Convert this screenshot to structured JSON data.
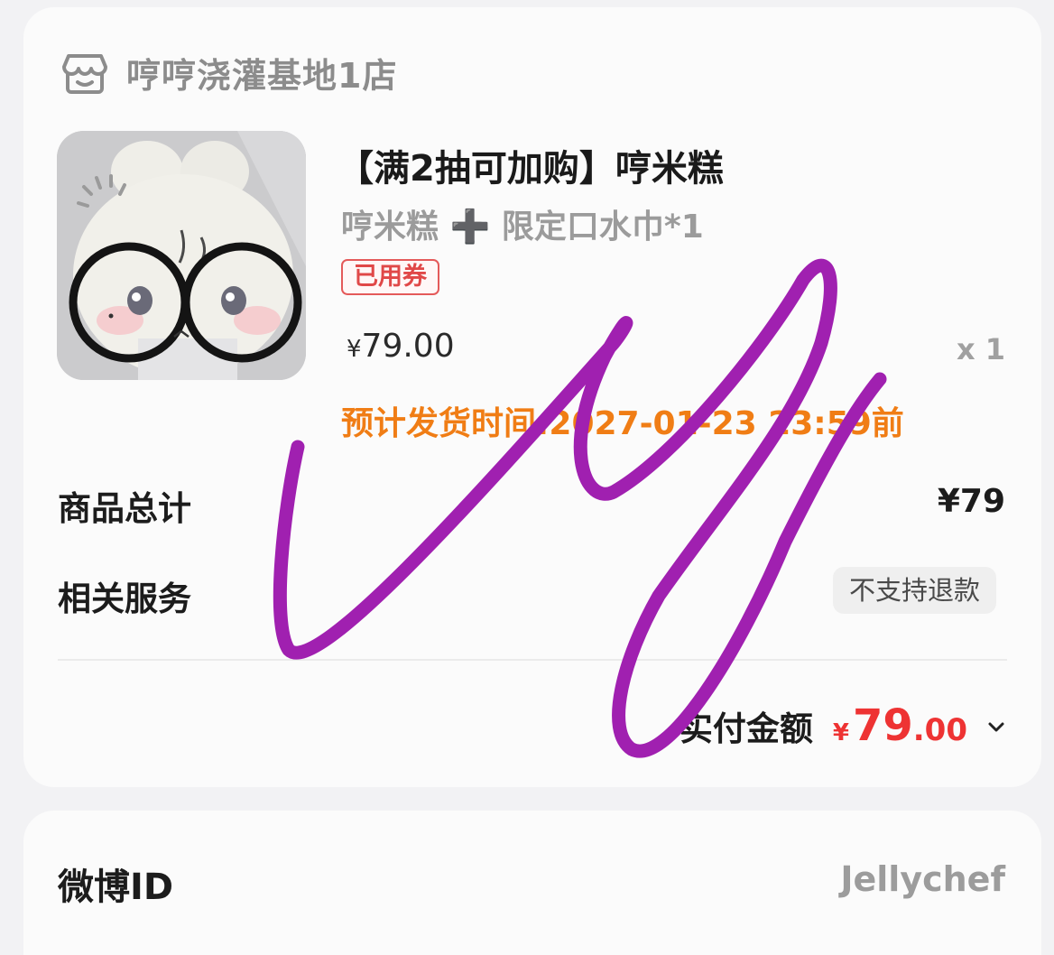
{
  "shop": {
    "name": "哼哼浇灌基地1店",
    "icon": "store-icon"
  },
  "product": {
    "title": "【满2抽可加购】哼米糕",
    "variant": "哼米糕 ➕ 限定口水巾*1",
    "coupon_badge": "已用券",
    "price_currency": "¥",
    "price_amount": "79.00",
    "quantity": "x 1",
    "shipping_note": "预计发货时间:2027-01-23 23:59前"
  },
  "summary": {
    "goods_total_label": "商品总计",
    "goods_total_value": "¥79",
    "service_label": "相关服务",
    "service_value": "不支持退款",
    "paid_label": "实付金额",
    "paid_currency": "¥",
    "paid_integer": "79",
    "paid_decimal": ".00"
  },
  "weibo": {
    "label": "微博ID",
    "value": "Jellychef"
  },
  "colors": {
    "accent_red": "#e33333",
    "ship_orange": "#f07d15",
    "scribble_purple": "#a020b0"
  }
}
